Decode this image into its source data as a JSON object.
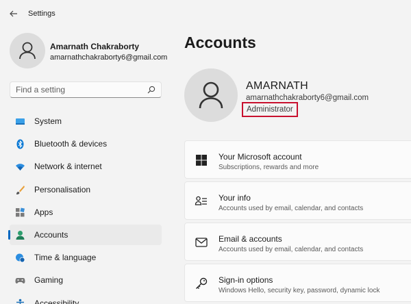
{
  "window": {
    "title": "Settings"
  },
  "profile": {
    "name": "Amarnath Chakraborty",
    "email": "amarnathchakraborty6@gmail.com"
  },
  "search": {
    "placeholder": "Find a setting"
  },
  "nav": {
    "items": [
      {
        "label": "System",
        "icon": "monitor-icon"
      },
      {
        "label": "Bluetooth & devices",
        "icon": "bluetooth-icon"
      },
      {
        "label": "Network & internet",
        "icon": "wifi-icon"
      },
      {
        "label": "Personalisation",
        "icon": "brush-icon"
      },
      {
        "label": "Apps",
        "icon": "apps-icon"
      },
      {
        "label": "Accounts",
        "icon": "person-icon",
        "active": true
      },
      {
        "label": "Time & language",
        "icon": "globe-clock-icon"
      },
      {
        "label": "Gaming",
        "icon": "gamepad-icon"
      },
      {
        "label": "Accessibility",
        "icon": "accessibility-icon"
      }
    ]
  },
  "main": {
    "title": "Accounts",
    "account": {
      "name": "AMARNATH",
      "email": "amarnathchakraborty6@gmail.com",
      "role": "Administrator"
    },
    "cards": [
      {
        "title": "Your Microsoft account",
        "subtitle": "Subscriptions, rewards and more",
        "icon": "windows-logo-icon"
      },
      {
        "title": "Your info",
        "subtitle": "Accounts used by email, calendar, and contacts",
        "icon": "contact-card-icon"
      },
      {
        "title": "Email & accounts",
        "subtitle": "Accounts used by email, calendar, and contacts",
        "icon": "mail-icon"
      },
      {
        "title": "Sign-in options",
        "subtitle": "Windows Hello, security key, password, dynamic lock",
        "icon": "key-icon"
      }
    ]
  },
  "colors": {
    "accent": "#0067c0",
    "highlight_box": "#c8102e",
    "background": "#f3f3f3"
  }
}
